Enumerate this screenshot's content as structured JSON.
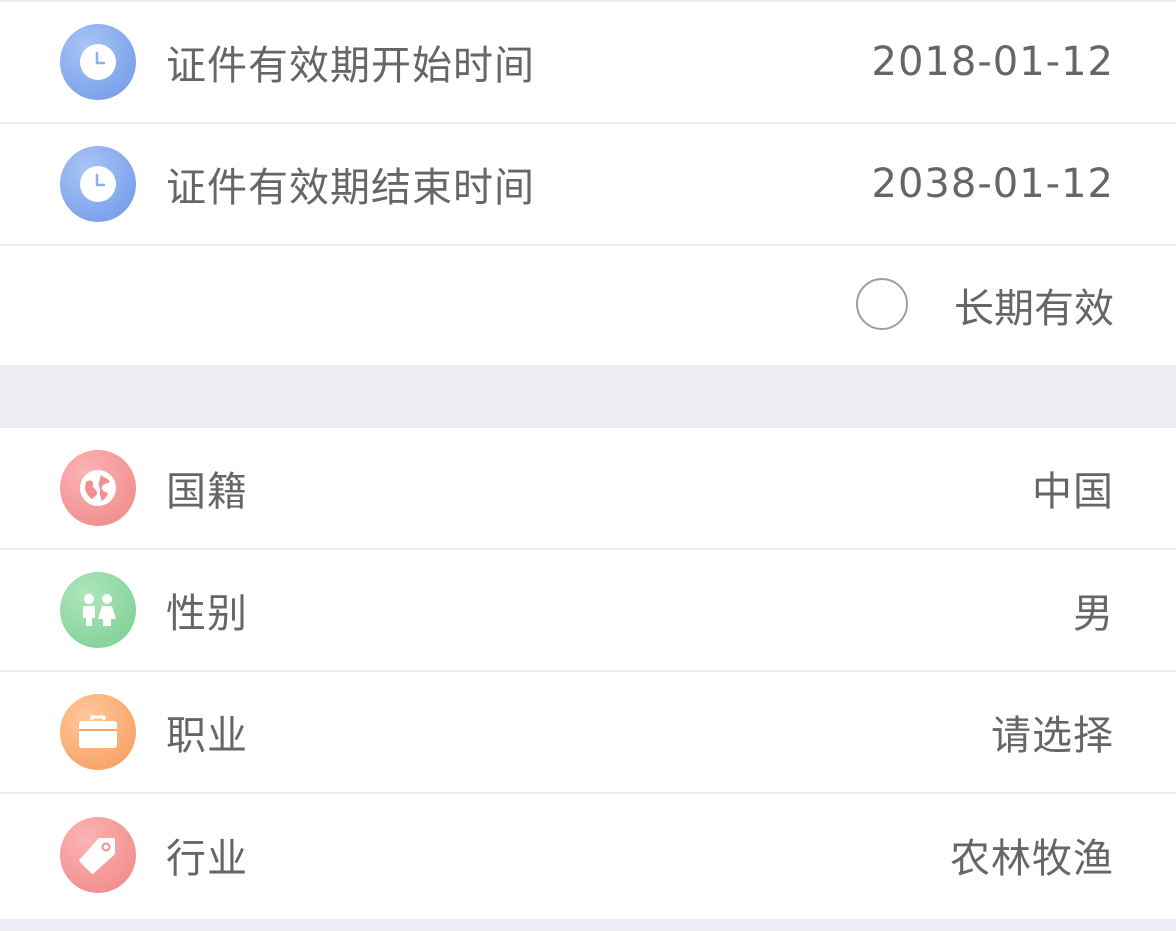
{
  "validity": {
    "start": {
      "label": "证件有效期开始时间",
      "value": "2018-01-12",
      "icon": "clock-icon"
    },
    "end": {
      "label": "证件有效期结束时间",
      "value": "2038-01-12",
      "icon": "clock-icon"
    },
    "long_term": {
      "label": "长期有效",
      "checked": false
    }
  },
  "profile": {
    "nationality": {
      "label": "国籍",
      "value": "中国",
      "icon": "globe-icon"
    },
    "gender": {
      "label": "性别",
      "value": "男",
      "icon": "people-icon"
    },
    "occupation": {
      "label": "职业",
      "value": "请选择",
      "icon": "briefcase-icon"
    },
    "industry": {
      "label": "行业",
      "value": "农林牧渔",
      "icon": "tag-icon"
    }
  },
  "colors": {
    "icon_blue": "#7fa4ec",
    "icon_red": "#f29090",
    "icon_green": "#86d39b",
    "icon_orange": "#f9a56b",
    "section_gap": "#ececf3",
    "text": "#666666"
  }
}
